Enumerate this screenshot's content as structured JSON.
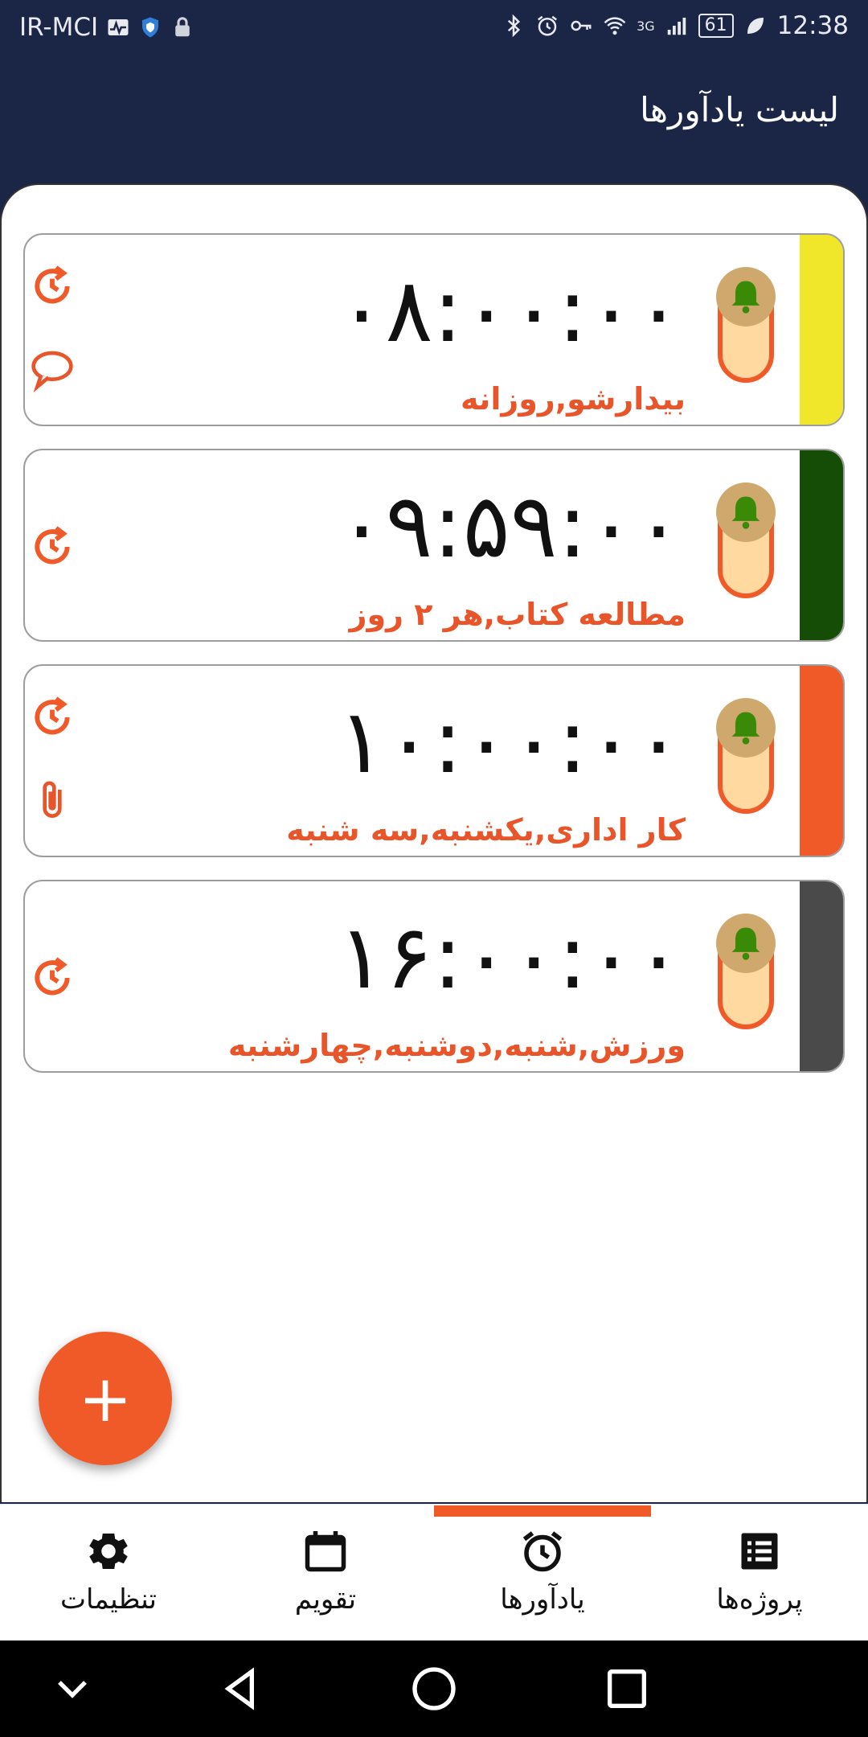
{
  "status_bar": {
    "carrier": "IR-MCI",
    "network": "3G",
    "battery": "61",
    "time": "12:38"
  },
  "appbar": {
    "title": "لیست یادآورها"
  },
  "reminders": [
    {
      "time": "۰۸:۰۰:۰۰",
      "label": "بیدارشو,روزانه",
      "color": "#f0e62a",
      "icons": [
        "alarm-repeat-icon",
        "message-icon"
      ]
    },
    {
      "time": "۰۹:۵۹:۰۰",
      "label": "مطالعه کتاب,هر ۲ روز",
      "color": "#154d07",
      "icons": [
        "alarm-repeat-icon"
      ]
    },
    {
      "time": "۱۰:۰۰:۰۰",
      "label": "کار اداری,یکشنبه,سه شنبه",
      "color": "#f05a28",
      "icons": [
        "alarm-repeat-icon",
        "attachment-icon"
      ]
    },
    {
      "time": "۱۶:۰۰:۰۰",
      "label": "ورزش,شنبه,دوشنبه,چهارشنبه",
      "color": "#4a4a4a",
      "icons": [
        "alarm-repeat-icon"
      ]
    }
  ],
  "fab": {
    "label": "+"
  },
  "bottom_nav": [
    {
      "label": "تنظیمات",
      "icon": "gear-icon"
    },
    {
      "label": "تقویم",
      "icon": "calendar-icon"
    },
    {
      "label": "یادآورها",
      "icon": "alarm-clock-icon",
      "active": true
    },
    {
      "label": "پروژه‌ها",
      "icon": "list-icon"
    }
  ],
  "colors": {
    "accent": "#f05a28",
    "appbar": "#1b2545"
  }
}
